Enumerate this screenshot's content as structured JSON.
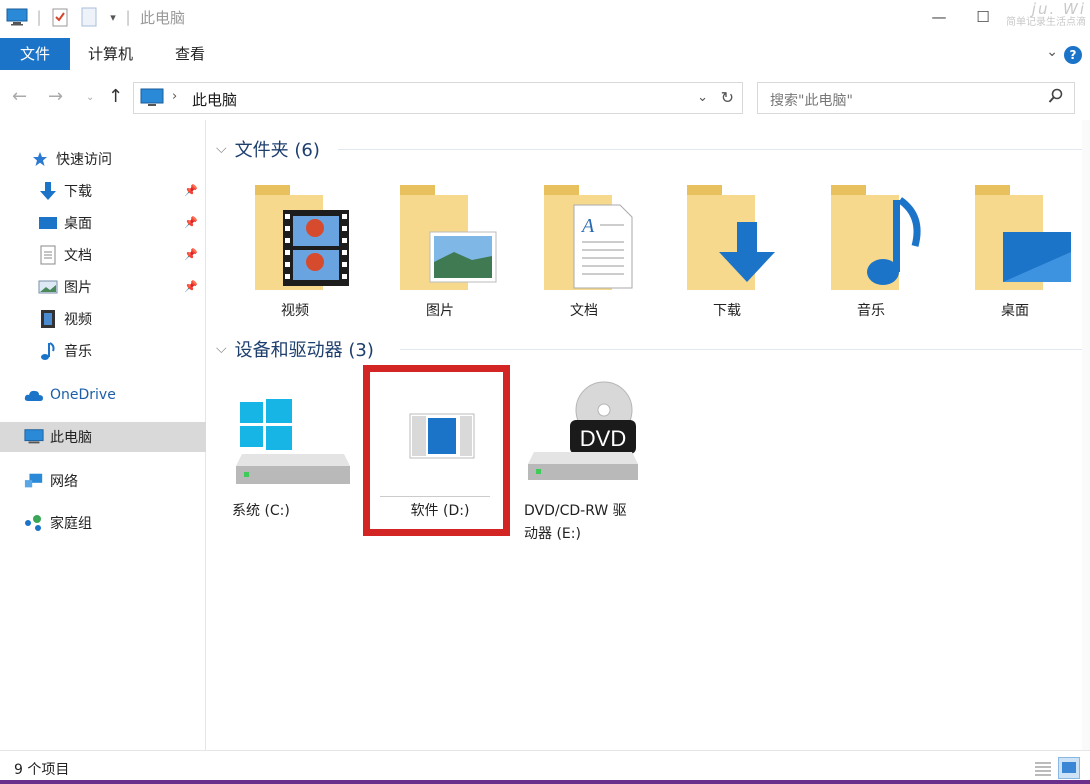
{
  "window": {
    "title": "此电脑"
  },
  "watermark": {
    "line1": "ju. Wi",
    "line2": "简单记录生活点滴"
  },
  "ribbon": {
    "tabs": [
      "文件",
      "计算机",
      "查看"
    ],
    "help": "?"
  },
  "address": {
    "path": "此电脑",
    "search_placeholder": "搜索\"此电脑\""
  },
  "sidebar": {
    "items": [
      {
        "label": "快速访问",
        "icon": "star-icon",
        "pinned": false
      },
      {
        "label": "下载",
        "icon": "download-icon",
        "pinned": true
      },
      {
        "label": "桌面",
        "icon": "desktop-icon",
        "pinned": true
      },
      {
        "label": "文档",
        "icon": "document-icon",
        "pinned": true
      },
      {
        "label": "图片",
        "icon": "picture-icon",
        "pinned": true
      },
      {
        "label": "视频",
        "icon": "video-icon",
        "pinned": false
      },
      {
        "label": "音乐",
        "icon": "music-icon",
        "pinned": false
      },
      {
        "label": "OneDrive",
        "icon": "cloud-icon",
        "pinned": false
      },
      {
        "label": "此电脑",
        "icon": "computer-icon",
        "pinned": false,
        "selected": true
      },
      {
        "label": "网络",
        "icon": "network-icon",
        "pinned": false
      },
      {
        "label": "家庭组",
        "icon": "homegroup-icon",
        "pinned": false
      }
    ]
  },
  "folders": {
    "title": "文件夹 (6)",
    "items": [
      {
        "label": "视频",
        "icon": "video-folder-icon"
      },
      {
        "label": "图片",
        "icon": "pictures-folder-icon"
      },
      {
        "label": "文档",
        "icon": "documents-folder-icon"
      },
      {
        "label": "下载",
        "icon": "downloads-folder-icon"
      },
      {
        "label": "音乐",
        "icon": "music-folder-icon"
      },
      {
        "label": "桌面",
        "icon": "desktop-folder-icon"
      }
    ]
  },
  "drives": {
    "title": "设备和驱动器 (3)",
    "items": [
      {
        "label": "系统 (C:)",
        "icon": "windows-drive-icon"
      },
      {
        "label": "软件 (D:)",
        "icon": "drive-icon",
        "highlighted": true
      },
      {
        "label_line1": "DVD/CD-RW 驱",
        "label_line2": "动器 (E:)",
        "icon": "dvd-drive-icon",
        "dvd_text": "DVD"
      }
    ]
  },
  "status": {
    "text": "9 个项目"
  },
  "colors": {
    "accent": "#1c74c9",
    "highlight": "#d32523",
    "folder": "#f3d27a"
  }
}
